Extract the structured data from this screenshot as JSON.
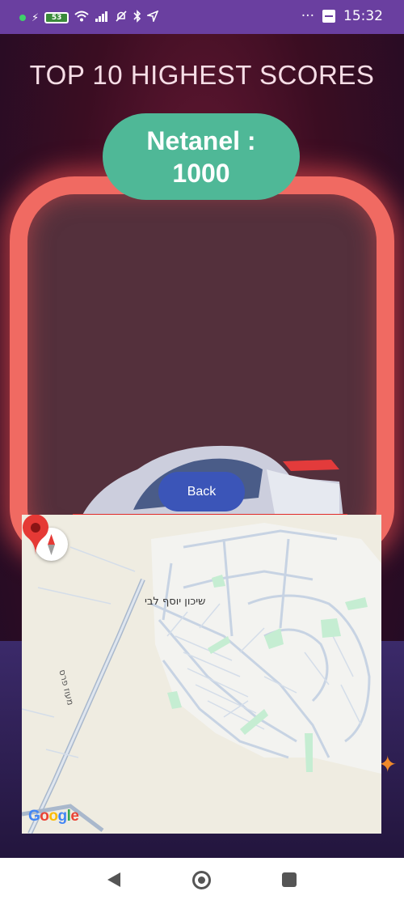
{
  "status_bar": {
    "battery": "53",
    "time": "15:32",
    "icons": [
      "dot-icon",
      "charging-icon",
      "battery-icon",
      "wifi-icon",
      "signal-icon",
      "mute-icon",
      "bluetooth-icon",
      "location-icon",
      "more-icon",
      "app-notification-icon"
    ],
    "overflow": "···"
  },
  "title": "TOP 10 HIGHEST SCORES",
  "score": {
    "name_line": "Netanel :",
    "value": "1000"
  },
  "back_button": "Back",
  "map": {
    "place_label": "שיכון יוסף לבי",
    "road_label": "מעוז פרס",
    "logo": {
      "G": "G",
      "o1": "o",
      "o2": "o",
      "g": "g",
      "l": "l",
      "e": "e"
    },
    "colors": {
      "land": "#efece1",
      "area": "#f3f3f0",
      "street": "#c7d3e3",
      "highway": "#a9b8cc",
      "park": "#c5edd2",
      "pin": "#e53935"
    }
  },
  "colors": {
    "pill": "#4fb897",
    "button": "#3b55b8",
    "title": "#f6dde6",
    "status_bar": "#6a3fa0"
  }
}
